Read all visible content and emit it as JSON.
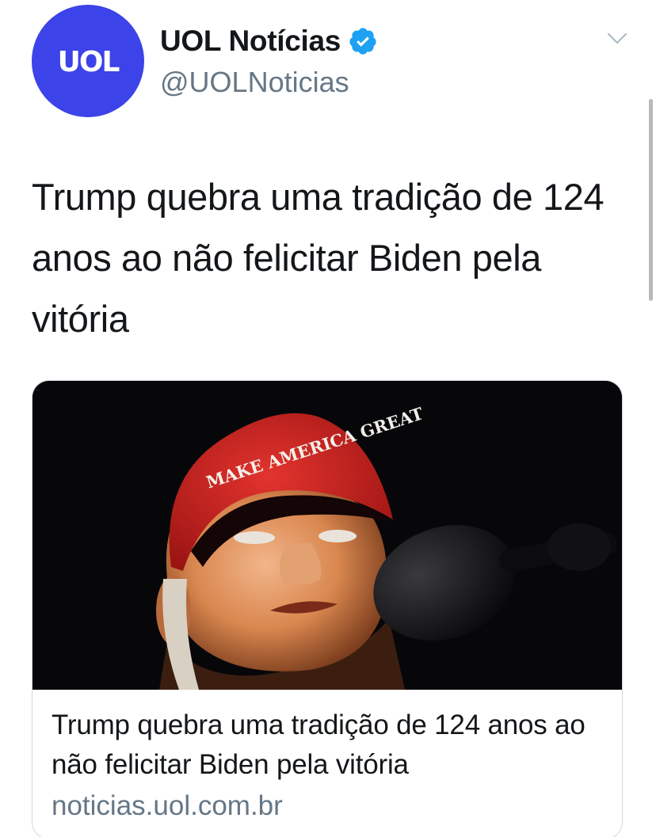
{
  "account": {
    "avatar_text": "UOL",
    "display_name": "UOL Notícias",
    "handle": "@UOLNoticias",
    "verified": true,
    "avatar_color": "#3c43e8",
    "verified_color": "#1da1f2"
  },
  "tweet": {
    "text": "Trump quebra uma tradição de 124 anos ao não felicitar Biden pela vitória"
  },
  "card": {
    "image_icon": "photo-thumbnail",
    "cap_text": "MAKE AMERICA GREAT",
    "title": "Trump quebra uma tradição de 124 anos ao não felicitar Biden pela vitória",
    "domain": "noticias.uol.com.br"
  },
  "icons": {
    "menu": "chevron-down-icon",
    "verified": "verified-badge-icon"
  }
}
